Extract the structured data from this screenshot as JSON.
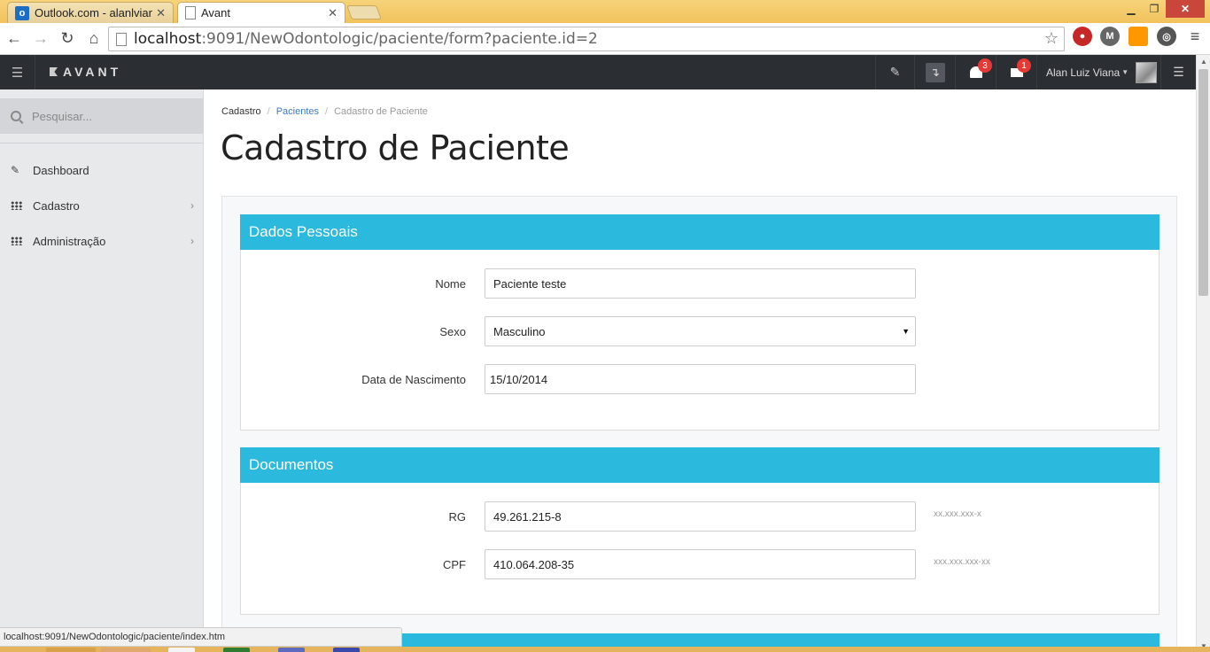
{
  "browser": {
    "tabs": [
      {
        "title": "Outlook.com - alanlviana@",
        "favicon": "outlook-icon",
        "active": false
      },
      {
        "title": "Avant",
        "favicon": "page-icon",
        "active": true
      }
    ],
    "url_host": "localhost",
    "url_rest": ":9091/NewOdontologic/paciente/form?paciente.id=2",
    "status_url": "localhost:9091/NewOdontologic/paciente/index.htm"
  },
  "navbar": {
    "brand": "AVANT",
    "notifications_count": "3",
    "messages_count": "1",
    "user_name": "Alan Luiz Viana"
  },
  "sidebar": {
    "search_placeholder": "Pesquisar...",
    "items": [
      {
        "label": "Dashboard",
        "icon": "pencil-icon"
      },
      {
        "label": "Cadastro",
        "icon": "grid-icon"
      },
      {
        "label": "Administração",
        "icon": "grid-icon"
      }
    ]
  },
  "breadcrumb": [
    "Cadastro",
    "Pacientes",
    "Cadastro de Paciente"
  ],
  "page_title": "Cadastro de Paciente",
  "sections": {
    "dados_pessoais": {
      "title": "Dados Pessoais",
      "fields": {
        "nome": {
          "label": "Nome",
          "value": "Paciente teste"
        },
        "sexo": {
          "label": "Sexo",
          "value": "Masculino"
        },
        "nascimento": {
          "label": "Data de Nascimento",
          "value": "15/10/2014"
        }
      }
    },
    "documentos": {
      "title": "Documentos",
      "fields": {
        "rg": {
          "label": "RG",
          "value": "49.261.215-8",
          "hint": "xx.xxx.xxx-x"
        },
        "cpf": {
          "label": "CPF",
          "value": "410.064.208-35",
          "hint": "xxx.xxx.xxx-xx"
        }
      }
    }
  },
  "colors": {
    "panel_header": "#2bb9dd",
    "navbar_bg": "#2b2e33",
    "badge": "#e53935",
    "link": "#3a7bc8"
  }
}
